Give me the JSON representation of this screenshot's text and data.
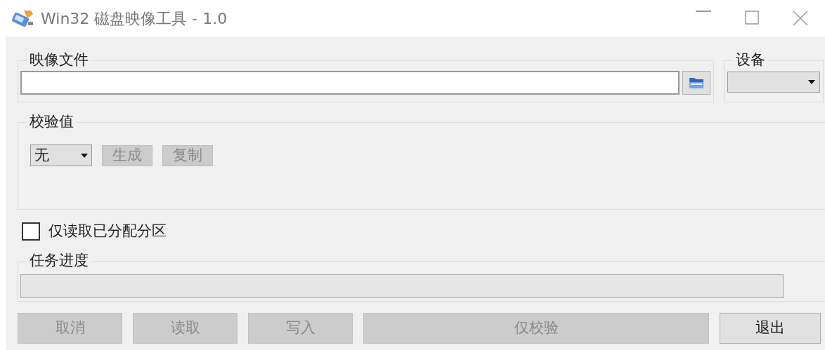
{
  "window": {
    "title": "Win32 磁盘映像工具 - 1.0"
  },
  "image_file": {
    "legend": "映像文件"
  },
  "device": {
    "legend": "设备"
  },
  "checksum": {
    "legend": "校验值",
    "algorithm": "无",
    "buttons": [
      {
        "label": "生成",
        "disabled": true
      },
      {
        "label": "复制",
        "disabled": true
      }
    ]
  },
  "read_only": {
    "label": "仅读取已分配分区",
    "checked": false
  },
  "progress": {
    "legend": "任务进度",
    "level": 0
  },
  "buttons": [
    {
      "label": "取消",
      "disabled": true,
      "wide": false
    },
    {
      "label": "读取",
      "disabled": true,
      "wide": false
    },
    {
      "label": "写入",
      "disabled": true,
      "wide": false
    },
    {
      "label": "仅校验",
      "disabled": true,
      "wide": true
    },
    {
      "label": "退出",
      "disabled": false,
      "wide": false
    }
  ]
}
